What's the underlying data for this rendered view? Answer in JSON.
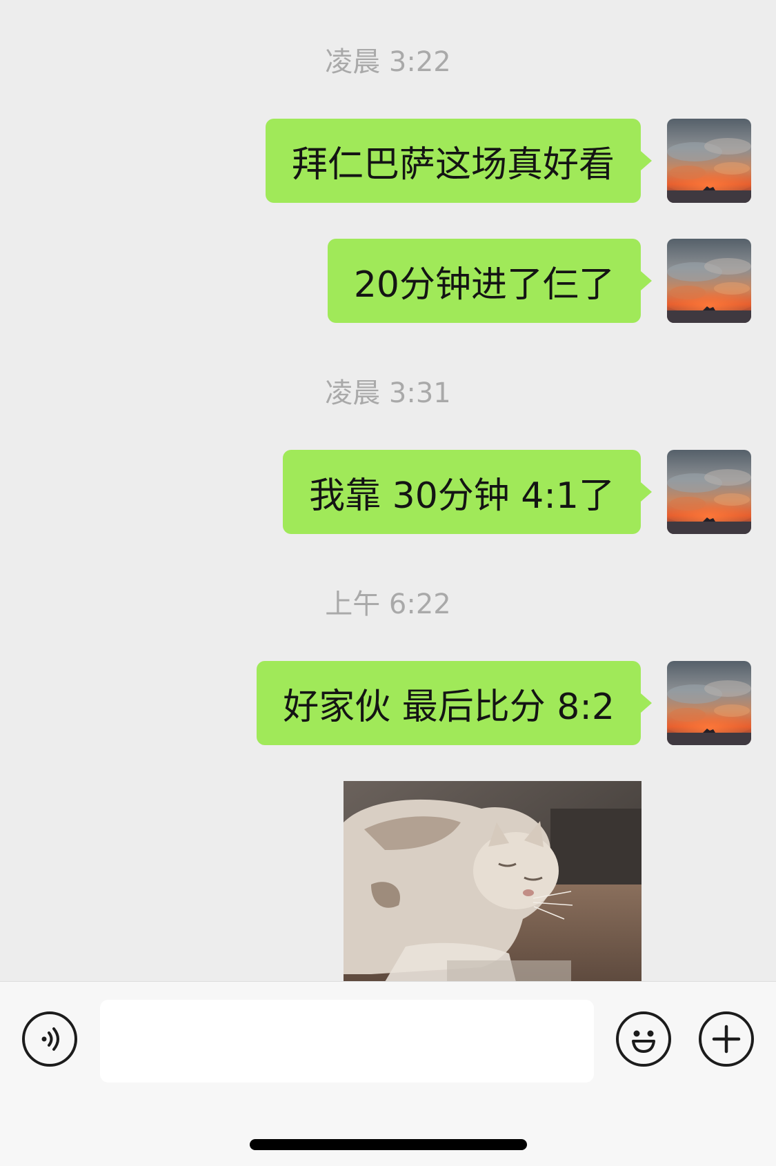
{
  "colors": {
    "background": "#ededed",
    "bubble_sent": "#a0e959",
    "timestamp_text": "#a9a9a9",
    "input_bar": "#f7f7f7"
  },
  "messages": [
    {
      "type": "timestamp",
      "text": "凌晨 3:22"
    },
    {
      "type": "text",
      "sender": "self",
      "text": "拜仁巴萨这场真好看"
    },
    {
      "type": "text",
      "sender": "self",
      "text": "20分钟进了仨了"
    },
    {
      "type": "timestamp",
      "text": "凌晨 3:31"
    },
    {
      "type": "text",
      "sender": "self",
      "text": "我靠 30分钟 4:1了"
    },
    {
      "type": "timestamp",
      "text": "上午 6:22"
    },
    {
      "type": "text",
      "sender": "self",
      "text": "好家伙 最后比分 8:2"
    },
    {
      "type": "sticker",
      "sender": "self",
      "icon": "cat-sticker"
    }
  ],
  "input_bar": {
    "voice_icon": "voice-icon",
    "input_value": "",
    "emoji_icon": "emoji-icon",
    "plus_icon": "plus-icon"
  }
}
